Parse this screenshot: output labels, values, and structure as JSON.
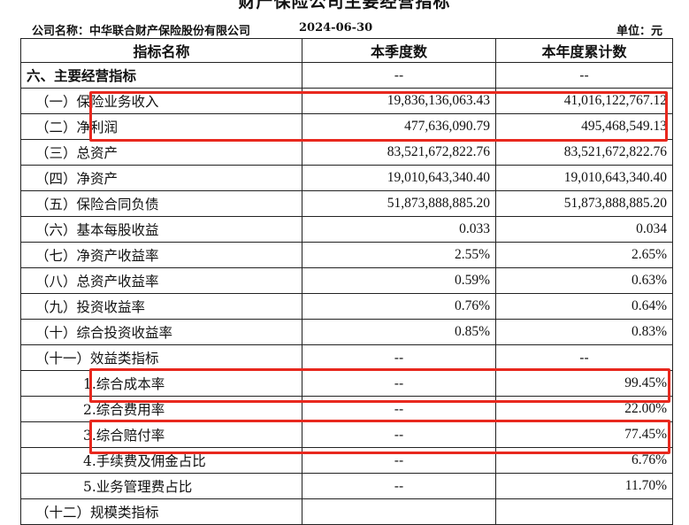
{
  "document": {
    "title": "财产保险公司主要经营指标",
    "company_label": "公司名称：中华联合财产保险股份有限公司",
    "date": "2024-06-30",
    "unit_label": "单位：元",
    "headers": [
      "指标名称",
      "本季度数",
      "本年度累计数"
    ],
    "rows": [
      {
        "name": "六、主要经营指标",
        "quarter": "--",
        "ytd": "--",
        "level": "section"
      },
      {
        "name": "（一）保险业务收入",
        "quarter": "19,836,136,063.43",
        "ytd": "41,016,122,767.12",
        "level": "item"
      },
      {
        "name": "（二）净利润",
        "quarter": "477,636,090.79",
        "ytd": "495,468,549.13",
        "level": "item"
      },
      {
        "name": "（三）总资产",
        "quarter": "83,521,672,822.76",
        "ytd": "83,521,672,822.76",
        "level": "item"
      },
      {
        "name": "（四）净资产",
        "quarter": "19,010,643,340.40",
        "ytd": "19,010,643,340.40",
        "level": "item"
      },
      {
        "name": "（五）保险合同负债",
        "quarter": "51,873,888,885.20",
        "ytd": "51,873,888,885.20",
        "level": "item"
      },
      {
        "name": "（六）基本每股收益",
        "quarter": "0.033",
        "ytd": "0.034",
        "level": "item"
      },
      {
        "name": "（七）净资产收益率",
        "quarter": "2.55%",
        "ytd": "2.65%",
        "level": "item"
      },
      {
        "name": "（八）总资产收益率",
        "quarter": "0.59%",
        "ytd": "0.63%",
        "level": "item"
      },
      {
        "name": "（九）投资收益率",
        "quarter": "0.76%",
        "ytd": "0.64%",
        "level": "item"
      },
      {
        "name": "（十）综合投资收益率",
        "quarter": "0.85%",
        "ytd": "0.83%",
        "level": "item"
      },
      {
        "name": "（十一）效益类指标",
        "quarter": "--",
        "ytd": "--",
        "level": "item"
      },
      {
        "name": "1.综合成本率",
        "quarter": "--",
        "ytd": "99.45%",
        "level": "sub"
      },
      {
        "name": "2.综合费用率",
        "quarter": "--",
        "ytd": "22.00%",
        "level": "sub"
      },
      {
        "name": "3.综合赔付率",
        "quarter": "--",
        "ytd": "77.45%",
        "level": "sub"
      },
      {
        "name": "4.手续费及佣金占比",
        "quarter": "--",
        "ytd": "6.76%",
        "level": "sub"
      },
      {
        "name": "5.业务管理费占比",
        "quarter": "--",
        "ytd": "11.70%",
        "level": "sub"
      },
      {
        "name": "（十二）规模类指标",
        "quarter": "",
        "ytd": "",
        "level": "item"
      }
    ],
    "highlight_color": "#e8281e"
  }
}
